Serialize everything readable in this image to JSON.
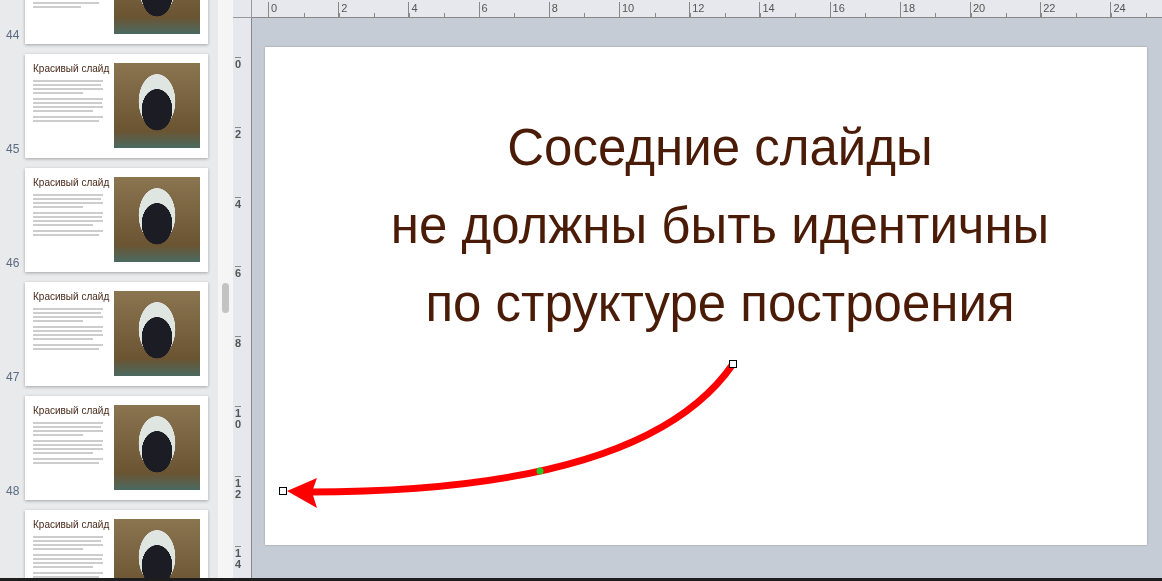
{
  "slide_panel": {
    "slides": [
      {
        "number": "44"
      },
      {
        "number": "45",
        "title": "Красивый слайд"
      },
      {
        "number": "46",
        "title": "Красивый слайд"
      },
      {
        "number": "47",
        "title": "Красивый слайд"
      },
      {
        "number": "48",
        "title": "Красивый слайд"
      },
      {
        "title": "Красивый слайд"
      }
    ]
  },
  "ruler_horizontal": {
    "labels": [
      "0",
      "2",
      "4",
      "6",
      "8",
      "10",
      "12",
      "14",
      "16",
      "18",
      "20",
      "22",
      "24"
    ]
  },
  "ruler_vertical": {
    "labels": [
      "0",
      "2",
      "4",
      "6",
      "8",
      "10",
      "12",
      "14"
    ]
  },
  "slide": {
    "title_lines": [
      "Соседние слайды",
      "не должны быть идентичны",
      "по структуре построения"
    ]
  }
}
